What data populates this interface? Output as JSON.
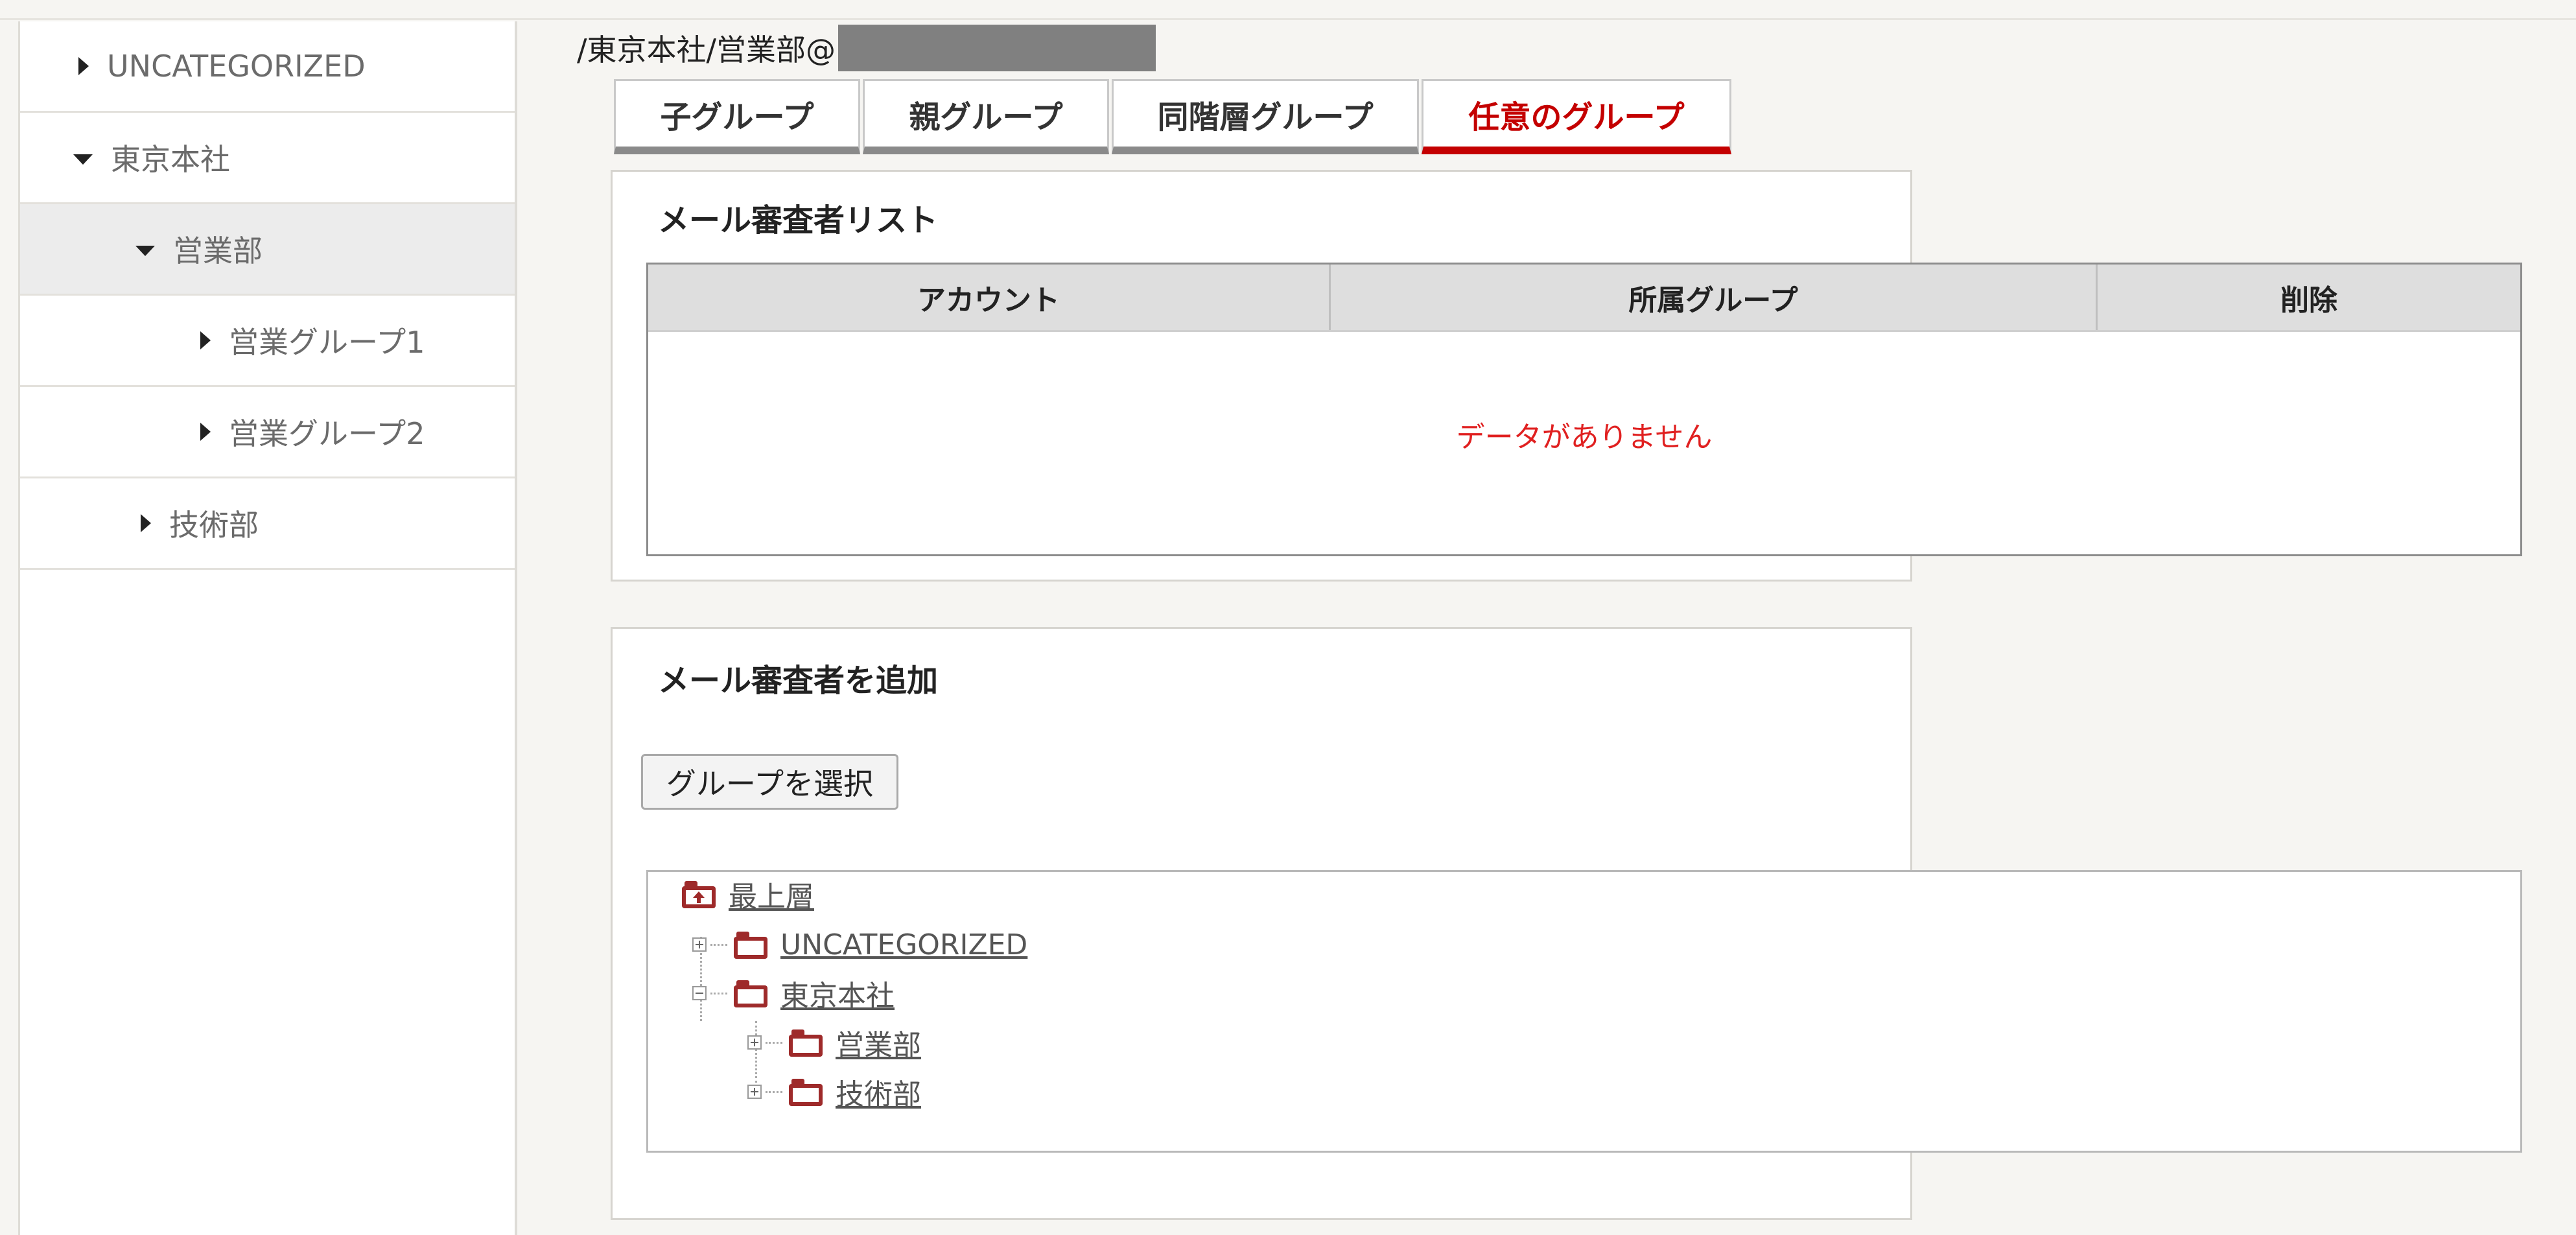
{
  "sidebar": {
    "items": [
      {
        "label": "UNCATEGORIZED",
        "expanded": false,
        "level": 0
      },
      {
        "label": "東京本社",
        "expanded": true,
        "level": 0
      },
      {
        "label": "営業部",
        "expanded": true,
        "level": 1,
        "active": true
      },
      {
        "label": "営業グループ1",
        "expanded": false,
        "level": 2
      },
      {
        "label": "営業グループ2",
        "expanded": false,
        "level": 2
      },
      {
        "label": "技術部",
        "expanded": false,
        "level": 1
      }
    ]
  },
  "breadcrumb": {
    "path": "/東京本社/営業部@"
  },
  "tabs": [
    {
      "label": "子グループ",
      "selected": false
    },
    {
      "label": "親グループ",
      "selected": false
    },
    {
      "label": "同階層グループ",
      "selected": false
    },
    {
      "label": "任意のグループ",
      "selected": true
    }
  ],
  "reviewer_list": {
    "title": "メール審査者リスト",
    "columns": [
      "アカウント",
      "所属グループ",
      "削除"
    ],
    "empty_message": "データがありません"
  },
  "add_reviewer": {
    "title": "メール審査者を追加",
    "select_group_button": "グループを選択",
    "tree": {
      "root": "最上層",
      "nodes": [
        {
          "label": "UNCATEGORIZED",
          "expander": "plus"
        },
        {
          "label": "東京本社",
          "expander": "minus"
        },
        {
          "label": "営業部",
          "expander": "plus"
        },
        {
          "label": "技術部",
          "expander": "plus"
        }
      ]
    }
  },
  "colors": {
    "accent_red": "#c40000",
    "empty_text": "#e02020",
    "folder": "#9e2a2a"
  }
}
